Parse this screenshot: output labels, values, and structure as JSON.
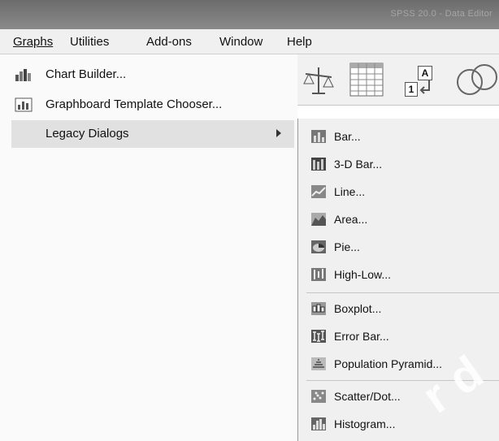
{
  "titlebar": {
    "text": "SPSS 20.0 - Data Editor"
  },
  "menubar": {
    "items": [
      {
        "key": "graphs",
        "label": "Graphs"
      },
      {
        "key": "utilities",
        "label": "Utilities"
      },
      {
        "key": "addons",
        "label": "Add-ons"
      },
      {
        "key": "window",
        "label": "Window"
      },
      {
        "key": "help",
        "label": "Help"
      }
    ]
  },
  "graphs_menu": {
    "items": [
      {
        "key": "chart_builder",
        "label": "Chart Builder...",
        "icon": "chart-builder-icon"
      },
      {
        "key": "graphboard",
        "label": "Graphboard Template Chooser...",
        "icon": "graphboard-icon"
      },
      {
        "key": "legacy",
        "label": "Legacy Dialogs",
        "has_submenu": true
      }
    ]
  },
  "toolbar": {
    "icons": [
      "balance-scale-icon",
      "data-grid-icon",
      "value-labels-icon",
      "venn-circles-icon"
    ],
    "value_labels_glyph": "A",
    "value_labels_num": "1"
  },
  "legacy_submenu": {
    "items": [
      {
        "key": "bar",
        "label": "Bar...",
        "icon": "bar-chart-icon"
      },
      {
        "key": "bar3d",
        "label": "3-D Bar...",
        "icon": "bar-3d-icon"
      },
      {
        "key": "line",
        "label": "Line...",
        "icon": "line-chart-icon"
      },
      {
        "key": "area",
        "label": "Area...",
        "icon": "area-chart-icon"
      },
      {
        "key": "pie",
        "label": "Pie...",
        "icon": "pie-chart-icon"
      },
      {
        "key": "highlow",
        "label": "High-Low...",
        "icon": "high-low-icon"
      },
      {
        "key": "boxplot",
        "label": "Boxplot...",
        "icon": "boxplot-icon"
      },
      {
        "key": "errorbar",
        "label": "Error Bar...",
        "icon": "error-bar-icon"
      },
      {
        "key": "pyramid",
        "label": "Population Pyramid...",
        "icon": "population-pyramid-icon"
      },
      {
        "key": "scatter",
        "label": "Scatter/Dot...",
        "icon": "scatter-dot-icon"
      },
      {
        "key": "histogram",
        "label": "Histogram...",
        "icon": "histogram-icon"
      }
    ]
  },
  "watermark": {
    "text": "r d"
  }
}
